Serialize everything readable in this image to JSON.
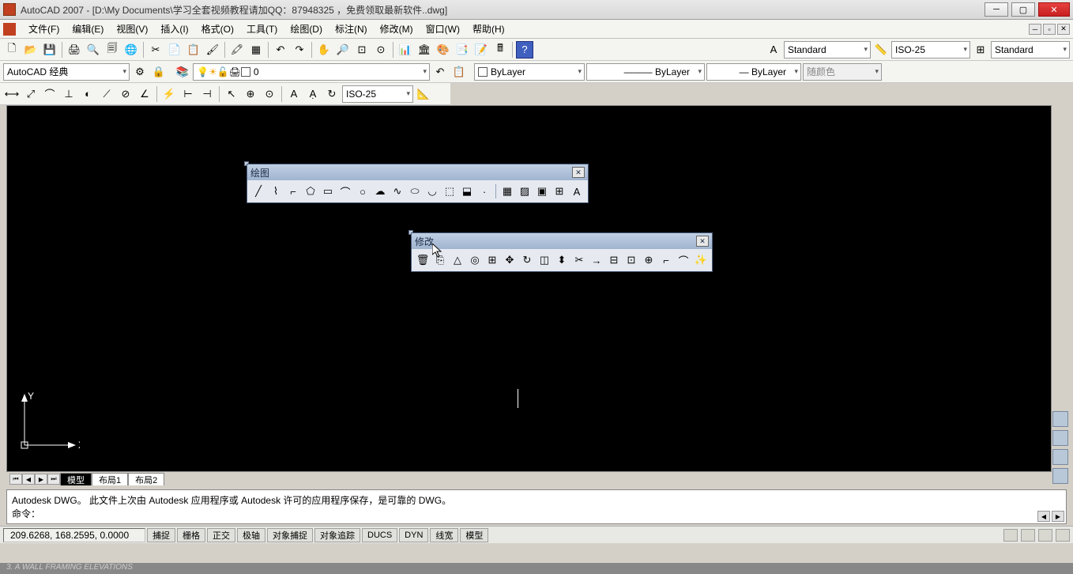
{
  "title": "AutoCAD 2007 - [D:\\My Documents\\学习全套视频教程请加QQ：87948325 ，免费领取最新软件..dwg]",
  "menus": [
    "文件(F)",
    "编辑(E)",
    "视图(V)",
    "插入(I)",
    "格式(O)",
    "工具(T)",
    "绘图(D)",
    "标注(N)",
    "修改(M)",
    "窗口(W)",
    "帮助(H)"
  ],
  "workspace_combo": "AutoCAD 经典",
  "layer_combo": "0",
  "text_style": "Standard",
  "dim_style": "ISO-25",
  "table_style": "Standard",
  "linetype1": "ByLayer",
  "linetype2": "ByLayer",
  "lineweight": "ByLayer",
  "plot_color": "随颜色",
  "dim_combo": "ISO-25",
  "float_draw_title": "绘图",
  "float_modify_title": "修改",
  "tabs": {
    "model": "模型",
    "layout1": "布局1",
    "layout2": "布局2"
  },
  "cmd_history": "Autodesk DWG。 此文件上次由 Autodesk 应用程序或 Autodesk 许可的应用程序保存，是可靠的 DWG。",
  "cmd_prompt": "命令：",
  "coords": "209.6268, 168.2595, 0.0000",
  "status_toggles": [
    "捕捉",
    "栅格",
    "正交",
    "极轴",
    "对象捕捉",
    "对象追踪",
    "DUCS",
    "DYN",
    "线宽",
    "模型"
  ],
  "bg_text": "3. A WALL FRAMING ELEVATIONS",
  "icons": {
    "new": "🗋",
    "open": "📂",
    "save": "💾",
    "print": "🖨",
    "preview": "🔍",
    "cut": "✂",
    "copy": "📄",
    "paste": "📋",
    "match": "🖌",
    "undo": "↶",
    "redo": "↷",
    "pan": "✋",
    "zoom": "🔍",
    "help": "?",
    "line": "╱",
    "cline": "⌇",
    "polyline": "⌐",
    "polygon": "⬠",
    "rect": "▭",
    "arc": "⌒",
    "circle": "○",
    "revcloud": "☁",
    "spline": "∿",
    "ellipse": "⬭",
    "ellipsearc": "◡",
    "block": "⬚",
    "point": "·",
    "hatch": "▦",
    "gradient": "▨",
    "region": "▣",
    "table": "⊞",
    "text": "A",
    "erase": "🗑",
    "copy2": "⎘",
    "mirror": "△",
    "offset": "◎",
    "array": "⊞",
    "move": "✥",
    "rotate": "↻",
    "scale": "◫",
    "stretch": "⬍",
    "trim": "✂",
    "extend": "→",
    "break": "⊟",
    "break2": "⊡",
    "join": "⊕",
    "chamfer": "⌐",
    "fillet": "⌒",
    "explode": "✨"
  }
}
